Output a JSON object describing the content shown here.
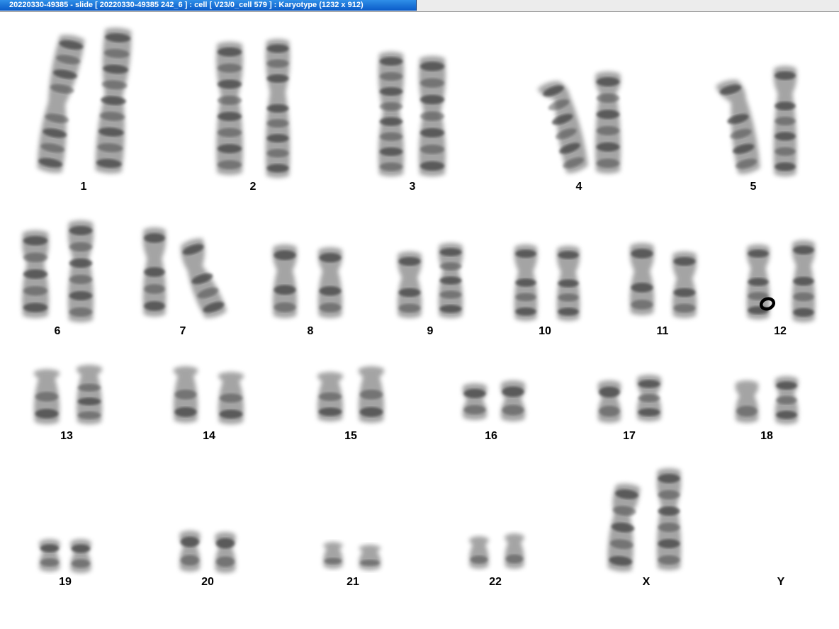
{
  "window": {
    "title": "20220330-49385 - slide [ 20220330-49385 242_6 ] : cell [ V23/0_cell 579 ] : Karyotype  (1232 x 912)"
  },
  "labels": {
    "c1": "1",
    "c2": "2",
    "c3": "3",
    "c4": "4",
    "c5": "5",
    "c6": "6",
    "c7": "7",
    "c8": "8",
    "c9": "9",
    "c10": "10",
    "c11": "11",
    "c12": "12",
    "c13": "13",
    "c14": "14",
    "c15": "15",
    "c16": "16",
    "c17": "17",
    "c18": "18",
    "c19": "19",
    "c20": "20",
    "c21": "21",
    "c22": "22",
    "cX": "X",
    "cY": "Y"
  },
  "colors": {
    "chromatid": "#5a5a5a",
    "band": "#3a3a3a",
    "marker": "#000000",
    "titlebar": "#1a73d9"
  }
}
